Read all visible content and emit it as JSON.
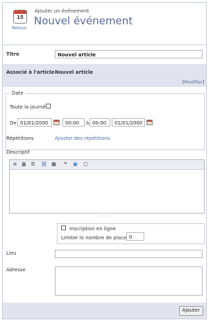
{
  "header": {
    "subtitle": "Ajouter un événement",
    "title": "Nouvel événement",
    "back_label": "Retour",
    "calendar_day": "15"
  },
  "form": {
    "titre_label": "Titre",
    "titre_value": "Nouvel article",
    "associe_label": "Associé à l'article",
    "associe_value": "Nouvel article",
    "modifier_open": "[",
    "modifier_label": "Modifier",
    "modifier_close": "]",
    "date_legend": "Date",
    "toute_journee_label": "Toute la journée",
    "de_label": "De",
    "date_start": "01/01/2000",
    "time_start": "00:00",
    "a_label": "à",
    "time_end": "00:00",
    "date_end": "01/01/2000",
    "repetitions_label": "Répétitions",
    "repetitions_link": "Ajouter des répétitions",
    "descriptif_label": "Descriptif",
    "grip": "......",
    "inscription_label": "Inscription en ligne",
    "limiter_label": "Limiter le nombre de places",
    "limiter_value": "0",
    "lieu_label": "Lieu",
    "adresse_label": "Adresse",
    "submit_label": "Ajouter"
  },
  "toolbar": {
    "icons": [
      "heading-icon",
      "bold-icon",
      "list-icon",
      "link-icon",
      "table-icon",
      "quote-icon",
      "image-icon",
      "fullscreen-icon"
    ],
    "bold_glyph": "B"
  }
}
